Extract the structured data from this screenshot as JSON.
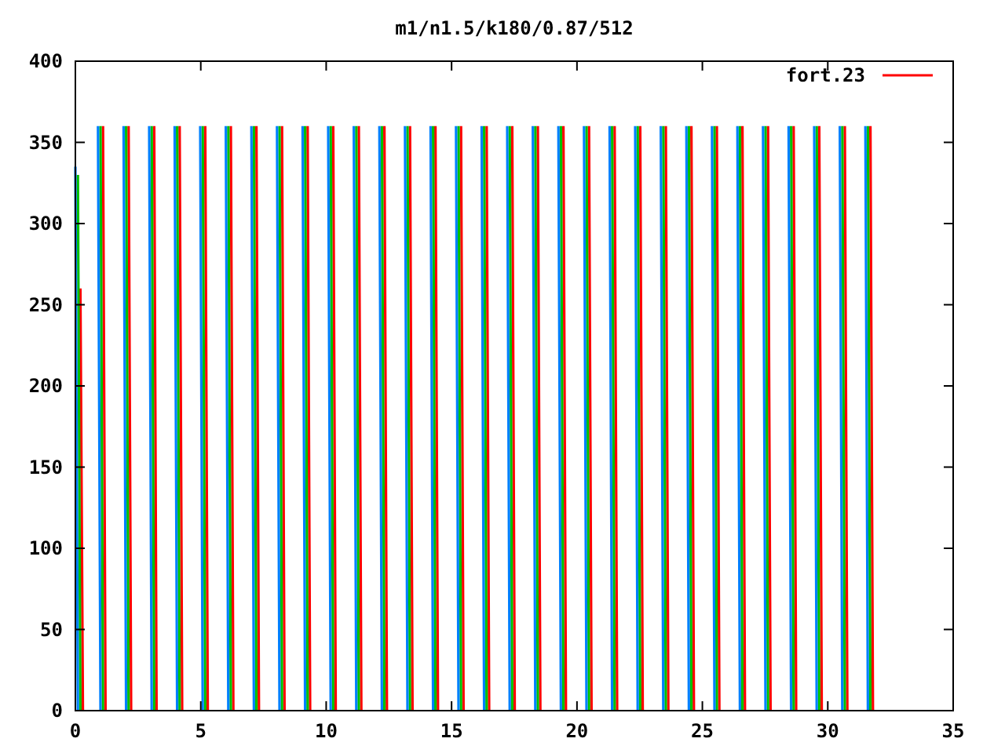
{
  "chart_data": {
    "type": "line",
    "title": "m1/n1.5/k180/0.87/512",
    "xlim": [
      0,
      35
    ],
    "ylim": [
      0,
      400
    ],
    "xticks": [
      0,
      5,
      10,
      15,
      20,
      25,
      30,
      35
    ],
    "yticks": [
      0,
      50,
      100,
      150,
      200,
      250,
      300,
      350,
      400
    ],
    "x": [
      0,
      0.1,
      0.2,
      0.3,
      0.9,
      1,
      1.1,
      1.2,
      1.92,
      2.02,
      2.12,
      2.22,
      2.94,
      3.04,
      3.14,
      3.24,
      3.96,
      4.06,
      4.16,
      4.26,
      4.98,
      5.08,
      5.18,
      5.28,
      6,
      6.1,
      6.2,
      6.3,
      7.02,
      7.12,
      7.22,
      7.32,
      8.04,
      8.14,
      8.24,
      8.34,
      9.06,
      9.16,
      9.26,
      9.36,
      10.08,
      10.18,
      10.28,
      10.38,
      11.1,
      11.2,
      11.3,
      11.4,
      12.12,
      12.22,
      12.32,
      12.42,
      13.14,
      13.24,
      13.34,
      13.44,
      14.16,
      14.26,
      14.36,
      14.46,
      15.18,
      15.28,
      15.38,
      15.48,
      16.2,
      16.3,
      16.4,
      16.5,
      17.22,
      17.32,
      17.42,
      17.52,
      18.24,
      18.34,
      18.44,
      18.54,
      19.26,
      19.36,
      19.46,
      19.56,
      20.28,
      20.38,
      20.48,
      20.58,
      21.3,
      21.4,
      21.5,
      21.6,
      22.32,
      22.42,
      22.52,
      22.62,
      23.34,
      23.44,
      23.54,
      23.64,
      24.36,
      24.46,
      24.56,
      24.66,
      25.38,
      25.48,
      25.58,
      25.68,
      26.4,
      26.5,
      26.6,
      26.7,
      27.42,
      27.52,
      27.62,
      27.72,
      28.44,
      28.54,
      28.64,
      28.74,
      29.46,
      29.56,
      29.66,
      29.76,
      30.48,
      30.58,
      30.68,
      30.78,
      31.5,
      31.6,
      31.7,
      31.8
    ],
    "series": [
      {
        "name": "fort.23",
        "color": "#ff0000",
        "values": [
          null,
          null,
          260,
          0,
          null,
          null,
          360,
          0,
          null,
          null,
          360,
          0,
          null,
          null,
          360,
          0,
          null,
          null,
          360,
          0,
          null,
          null,
          360,
          0,
          null,
          null,
          360,
          0,
          null,
          null,
          360,
          0,
          null,
          null,
          360,
          0,
          null,
          null,
          360,
          0,
          null,
          null,
          360,
          0,
          null,
          null,
          360,
          0,
          null,
          null,
          360,
          0,
          null,
          null,
          360,
          0,
          null,
          null,
          360,
          0,
          null,
          null,
          360,
          0,
          null,
          null,
          360,
          0,
          null,
          null,
          360,
          0,
          null,
          null,
          360,
          0,
          null,
          null,
          360,
          0,
          null,
          null,
          360,
          0,
          null,
          null,
          360,
          0,
          null,
          null,
          360,
          0,
          null,
          null,
          360,
          0,
          null,
          null,
          360,
          0,
          null,
          null,
          360,
          0,
          null,
          null,
          360,
          0,
          null,
          null,
          360,
          0,
          null,
          null,
          360,
          0,
          null,
          null,
          360,
          0,
          null,
          null,
          360,
          0,
          null,
          null,
          360,
          0
        ]
      },
      {
        "color": "#00c000",
        "values": [
          null,
          330,
          0,
          null,
          null,
          360,
          0,
          null,
          null,
          360,
          0,
          null,
          null,
          360,
          0,
          null,
          null,
          360,
          0,
          null,
          null,
          360,
          0,
          null,
          null,
          360,
          0,
          null,
          null,
          360,
          0,
          null,
          null,
          360,
          0,
          null,
          null,
          360,
          0,
          null,
          null,
          360,
          0,
          null,
          null,
          360,
          0,
          null,
          null,
          360,
          0,
          null,
          null,
          360,
          0,
          null,
          null,
          360,
          0,
          null,
          null,
          360,
          0,
          null,
          null,
          360,
          0,
          null,
          null,
          360,
          0,
          null,
          null,
          360,
          0,
          null,
          null,
          360,
          0,
          null,
          null,
          360,
          0,
          null,
          null,
          360,
          0,
          null,
          null,
          360,
          0,
          null,
          null,
          360,
          0,
          null,
          null,
          360,
          0,
          null,
          null,
          360,
          0,
          null,
          null,
          360,
          0,
          null,
          null,
          360,
          0,
          null,
          null,
          360,
          0,
          null,
          null,
          360,
          0,
          null,
          null,
          360,
          0,
          null,
          null,
          360,
          0,
          null
        ]
      },
      {
        "color": "#0080ff",
        "values": [
          335,
          0,
          null,
          null,
          360,
          0,
          null,
          null,
          360,
          0,
          null,
          null,
          360,
          0,
          null,
          null,
          360,
          0,
          null,
          null,
          360,
          0,
          null,
          null,
          360,
          0,
          null,
          null,
          360,
          0,
          null,
          null,
          360,
          0,
          null,
          null,
          360,
          0,
          null,
          null,
          360,
          0,
          null,
          null,
          360,
          0,
          null,
          null,
          360,
          0,
          null,
          null,
          360,
          0,
          null,
          null,
          360,
          0,
          null,
          null,
          360,
          0,
          null,
          null,
          360,
          0,
          null,
          null,
          360,
          0,
          null,
          null,
          360,
          0,
          null,
          null,
          360,
          0,
          null,
          null,
          360,
          0,
          null,
          null,
          360,
          0,
          null,
          null,
          360,
          0,
          null,
          null,
          360,
          0,
          null,
          null,
          360,
          0,
          null,
          null,
          360,
          0,
          null,
          null,
          360,
          0,
          null,
          null,
          360,
          0,
          null,
          null,
          360,
          0,
          null,
          null,
          360,
          0,
          null,
          null,
          360,
          0,
          null,
          null,
          360,
          0,
          null,
          null
        ]
      }
    ]
  }
}
